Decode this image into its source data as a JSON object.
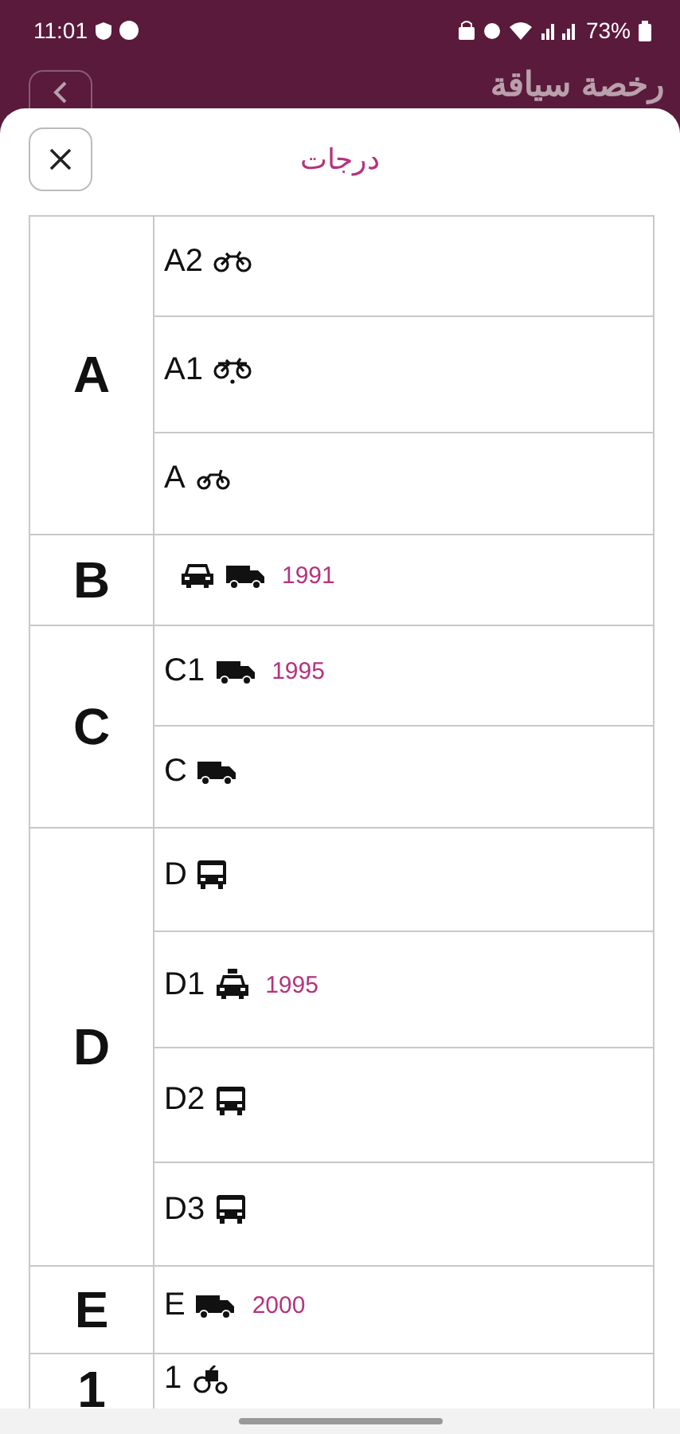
{
  "status_bar": {
    "time": "11:01",
    "battery": "73%"
  },
  "header": {
    "title": "رخصة سياقة"
  },
  "sheet": {
    "title": "درجات"
  },
  "groups": [
    {
      "code": "A",
      "rows": [
        {
          "code": "A2",
          "icons": [
            {
              "kind": "motorcycle"
            }
          ]
        },
        {
          "code": "A1",
          "icons": [
            {
              "kind": "moped"
            }
          ]
        },
        {
          "code": "A",
          "icons": [
            {
              "kind": "scooter"
            }
          ]
        }
      ]
    },
    {
      "code": "B",
      "rows": [
        {
          "icons": [
            {
              "kind": "car"
            },
            {
              "kind": "truck"
            }
          ],
          "year": "1991"
        }
      ]
    },
    {
      "code": "C",
      "rows": [
        {
          "code": "C1",
          "icons": [
            {
              "kind": "truck"
            }
          ],
          "year": "1995"
        },
        {
          "code": "C",
          "icons": [
            {
              "kind": "truck"
            }
          ]
        }
      ]
    },
    {
      "code": "D",
      "rows": [
        {
          "code": "D",
          "icons": [
            {
              "kind": "bus"
            }
          ]
        },
        {
          "code": "D1",
          "icons": [
            {
              "kind": "taxi"
            }
          ],
          "year": "1995"
        },
        {
          "code": "D2",
          "icons": [
            {
              "kind": "bus"
            }
          ]
        },
        {
          "code": "D3",
          "icons": [
            {
              "kind": "bus"
            }
          ]
        }
      ]
    },
    {
      "code": "E",
      "rows": [
        {
          "code": "E",
          "icons": [
            {
              "kind": "truck"
            }
          ],
          "year": "2000"
        }
      ]
    },
    {
      "code": "1",
      "rows": [
        {
          "code": "1",
          "icons": [
            {
              "kind": "tractor"
            }
          ]
        }
      ]
    }
  ]
}
